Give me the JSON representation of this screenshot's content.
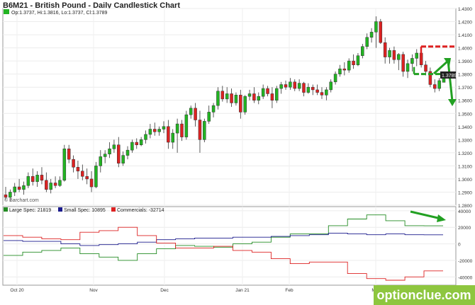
{
  "chart_data": [
    {
      "type": "candlestick",
      "title": "B6M21 - British Pound - Daily Candlestick Chart",
      "ohlc_label": "Op:1.3737, Hi:1.3816, Lo:1.3737, Cl:1.3789",
      "last_price_label": "1.3789",
      "watermark": "© Barchart.com",
      "ylim": [
        1.28,
        1.43
      ],
      "y_ticks": [
        "1.4300",
        "1.4200",
        "1.4100",
        "1.4000",
        "1.3900",
        "1.3800",
        "1.3700",
        "1.3600",
        "1.3500",
        "1.3400",
        "1.3300",
        "1.3200",
        "1.3100",
        "1.3000",
        "1.2900",
        "1.2800"
      ],
      "x_ticks": [
        "Oct 20",
        "Nov",
        "Dec",
        "Jan 21",
        "Feb",
        "Mar"
      ],
      "colors": {
        "up": "#22b422",
        "down": "#dd2222",
        "annotation_red": "#dd2222",
        "annotation_green": "#22a022"
      },
      "candles": [
        [
          1.288,
          1.294,
          1.284,
          1.286
        ],
        [
          1.286,
          1.292,
          1.283,
          1.29
        ],
        [
          1.29,
          1.297,
          1.287,
          1.294
        ],
        [
          1.294,
          1.3,
          1.29,
          1.292
        ],
        [
          1.292,
          1.298,
          1.288,
          1.295
        ],
        [
          1.295,
          1.305,
          1.293,
          1.302
        ],
        [
          1.302,
          1.308,
          1.295,
          1.298
        ],
        [
          1.298,
          1.306,
          1.294,
          1.303
        ],
        [
          1.303,
          1.309,
          1.296,
          1.299
        ],
        [
          1.299,
          1.305,
          1.29,
          1.292
        ],
        [
          1.292,
          1.3,
          1.289,
          1.297
        ],
        [
          1.297,
          1.302,
          1.293,
          1.295
        ],
        [
          1.295,
          1.302,
          1.294,
          1.299
        ],
        [
          1.299,
          1.326,
          1.298,
          1.323
        ],
        [
          1.323,
          1.326,
          1.312,
          1.315
        ],
        [
          1.315,
          1.318,
          1.305,
          1.309
        ],
        [
          1.309,
          1.314,
          1.3,
          1.306
        ],
        [
          1.306,
          1.311,
          1.299,
          1.302
        ],
        [
          1.302,
          1.308,
          1.296,
          1.3
        ],
        [
          1.3,
          1.306,
          1.29,
          1.294
        ],
        [
          1.294,
          1.313,
          1.293,
          1.31
        ],
        [
          1.31,
          1.322,
          1.305,
          1.317
        ],
        [
          1.317,
          1.322,
          1.312,
          1.319
        ],
        [
          1.319,
          1.328,
          1.316,
          1.323
        ],
        [
          1.323,
          1.33,
          1.32,
          1.326
        ],
        [
          1.326,
          1.332,
          1.309,
          1.312
        ],
        [
          1.312,
          1.321,
          1.31,
          1.318
        ],
        [
          1.318,
          1.325,
          1.315,
          1.322
        ],
        [
          1.322,
          1.33,
          1.32,
          1.328
        ],
        [
          1.328,
          1.331,
          1.323,
          1.326
        ],
        [
          1.326,
          1.332,
          1.325,
          1.33
        ],
        [
          1.33,
          1.337,
          1.327,
          1.334
        ],
        [
          1.334,
          1.342,
          1.331,
          1.338
        ],
        [
          1.338,
          1.343,
          1.333,
          1.336
        ],
        [
          1.336,
          1.34,
          1.333,
          1.338
        ],
        [
          1.338,
          1.344,
          1.335,
          1.34
        ],
        [
          1.34,
          1.345,
          1.323,
          1.328
        ],
        [
          1.328,
          1.338,
          1.323,
          1.335
        ],
        [
          1.335,
          1.346,
          1.32,
          1.342
        ],
        [
          1.342,
          1.345,
          1.329,
          1.332
        ],
        [
          1.332,
          1.352,
          1.33,
          1.349
        ],
        [
          1.349,
          1.356,
          1.346,
          1.354
        ],
        [
          1.354,
          1.358,
          1.34,
          1.345
        ],
        [
          1.345,
          1.352,
          1.32,
          1.33
        ],
        [
          1.33,
          1.346,
          1.328,
          1.344
        ],
        [
          1.344,
          1.356,
          1.342,
          1.351
        ],
        [
          1.351,
          1.358,
          1.347,
          1.356
        ],
        [
          1.356,
          1.37,
          1.353,
          1.367
        ],
        [
          1.367,
          1.371,
          1.359,
          1.361
        ],
        [
          1.361,
          1.37,
          1.358,
          1.365
        ],
        [
          1.365,
          1.369,
          1.355,
          1.358
        ],
        [
          1.358,
          1.366,
          1.356,
          1.364
        ],
        [
          1.364,
          1.368,
          1.346,
          1.351
        ],
        [
          1.351,
          1.364,
          1.349,
          1.363
        ],
        [
          1.363,
          1.368,
          1.36,
          1.365
        ],
        [
          1.365,
          1.37,
          1.358,
          1.36
        ],
        [
          1.36,
          1.366,
          1.357,
          1.363
        ],
        [
          1.363,
          1.372,
          1.361,
          1.369
        ],
        [
          1.369,
          1.371,
          1.363,
          1.365
        ],
        [
          1.365,
          1.37,
          1.354,
          1.36
        ],
        [
          1.36,
          1.371,
          1.358,
          1.369
        ],
        [
          1.369,
          1.374,
          1.365,
          1.372
        ],
        [
          1.372,
          1.375,
          1.368,
          1.37
        ],
        [
          1.37,
          1.377,
          1.368,
          1.374
        ],
        [
          1.374,
          1.376,
          1.367,
          1.369
        ],
        [
          1.369,
          1.376,
          1.367,
          1.373
        ],
        [
          1.373,
          1.374,
          1.363,
          1.366
        ],
        [
          1.366,
          1.373,
          1.365,
          1.37
        ],
        [
          1.37,
          1.372,
          1.364,
          1.368
        ],
        [
          1.368,
          1.372,
          1.364,
          1.366
        ],
        [
          1.366,
          1.37,
          1.361,
          1.364
        ],
        [
          1.364,
          1.37,
          1.36,
          1.368
        ],
        [
          1.368,
          1.376,
          1.366,
          1.374
        ],
        [
          1.374,
          1.382,
          1.372,
          1.38
        ],
        [
          1.38,
          1.387,
          1.378,
          1.384
        ],
        [
          1.384,
          1.389,
          1.379,
          1.383
        ],
        [
          1.383,
          1.392,
          1.381,
          1.39
        ],
        [
          1.39,
          1.395,
          1.384,
          1.387
        ],
        [
          1.387,
          1.396,
          1.386,
          1.394
        ],
        [
          1.394,
          1.403,
          1.392,
          1.401
        ],
        [
          1.401,
          1.411,
          1.399,
          1.408
        ],
        [
          1.408,
          1.415,
          1.404,
          1.412
        ],
        [
          1.412,
          1.424,
          1.4,
          1.42
        ],
        [
          1.42,
          1.422,
          1.403,
          1.404
        ],
        [
          1.404,
          1.408,
          1.388,
          1.393
        ],
        [
          1.393,
          1.4,
          1.388,
          1.398
        ],
        [
          1.398,
          1.401,
          1.388,
          1.391
        ],
        [
          1.391,
          1.396,
          1.383,
          1.395
        ],
        [
          1.395,
          1.397,
          1.378,
          1.382
        ],
        [
          1.382,
          1.391,
          1.377,
          1.388
        ],
        [
          1.388,
          1.395,
          1.382,
          1.392
        ],
        [
          1.392,
          1.399,
          1.386,
          1.396
        ],
        [
          1.396,
          1.399,
          1.385,
          1.387
        ],
        [
          1.387,
          1.39,
          1.379,
          1.382
        ],
        [
          1.382,
          1.385,
          1.37,
          1.372
        ],
        [
          1.372,
          1.376,
          1.366,
          1.369
        ],
        [
          1.369,
          1.377,
          1.367,
          1.375
        ],
        [
          1.3737,
          1.3816,
          1.3737,
          1.3789
        ]
      ],
      "annotations": {
        "resistance_level": 1.401,
        "support_level": 1.38
      }
    },
    {
      "type": "line",
      "legend": [
        {
          "label": "Large Spec: 21819",
          "color": "#228b22"
        },
        {
          "label": "Small Spec: 10895",
          "color": "#1a1a8c"
        },
        {
          "label": "Commercials: -32714",
          "color": "#dd2222"
        }
      ],
      "ylim": [
        -50000,
        45000
      ],
      "y_ticks": [
        "40000",
        "20000",
        "0",
        "-20000",
        "-40000"
      ],
      "series": [
        {
          "name": "Large Spec: 21819",
          "step": true,
          "values": [
            -14000,
            -10000,
            -8000,
            -5000,
            -12000,
            -16000,
            -20000,
            -12000,
            -6000,
            -2000,
            -3000,
            -4000,
            0,
            2000,
            8000,
            12000,
            12000,
            22000,
            30000,
            35000,
            28000,
            22000,
            21819
          ]
        },
        {
          "name": "Small Spec: 10895",
          "step": true,
          "values": [
            4000,
            3000,
            3000,
            0,
            -2000,
            -1000,
            0,
            2000,
            5000,
            6000,
            7000,
            7000,
            8000,
            8000,
            9000,
            10000,
            11000,
            13000,
            12000,
            11000,
            12000,
            11000,
            10895
          ]
        },
        {
          "name": "Commercials: -32714",
          "step": true,
          "values": [
            10000,
            8000,
            6000,
            5000,
            14000,
            16000,
            20000,
            10000,
            1000,
            -5000,
            -5000,
            -3000,
            -8000,
            -10000,
            -18000,
            -24000,
            -22000,
            -22000,
            -36000,
            -42000,
            -44000,
            -40000,
            -32714
          ]
        }
      ]
    }
  ],
  "site_badge": {
    "text": "optionclue.com"
  }
}
